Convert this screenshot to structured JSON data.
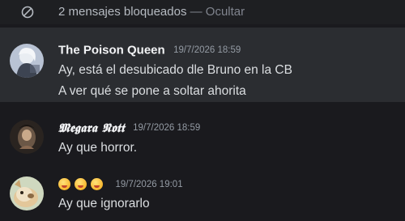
{
  "blocked": {
    "text": "2 mensajes bloqueados",
    "separator": "—",
    "hide_link": "Ocultar",
    "icon": "blocked-circle-icon"
  },
  "messages": [
    {
      "author": "The Poison Queen",
      "timestamp": "19/7/2026 18:59",
      "avatar_icon": "avatar-white-haired-figure",
      "lines": [
        "Ay, está el desubicado dle Bruno en la CB",
        "A ver qué se pone a soltar ahorita"
      ]
    },
    {
      "author": "𝕸𝖊𝖌𝖆𝖗𝖆 𝕹𝖔𝖙𝖙",
      "timestamp": "19/7/2026 18:59",
      "avatar_icon": "avatar-dark-figure",
      "lines": [
        "Ay que horror."
      ]
    },
    {
      "author_emojis": [
        "smiling-face-with-hearts-emoji",
        "woozy-face-emoji",
        "tongue-out-face-emoji"
      ],
      "timestamp": "19/7/2026 19:01",
      "avatar_icon": "avatar-animal",
      "lines": [
        "Ay que ignorarlo"
      ]
    }
  ],
  "colors": {
    "background": "#1a1a1e",
    "highlight": "#2b2d31",
    "text": "#dbdee1",
    "muted": "#949ba4"
  }
}
